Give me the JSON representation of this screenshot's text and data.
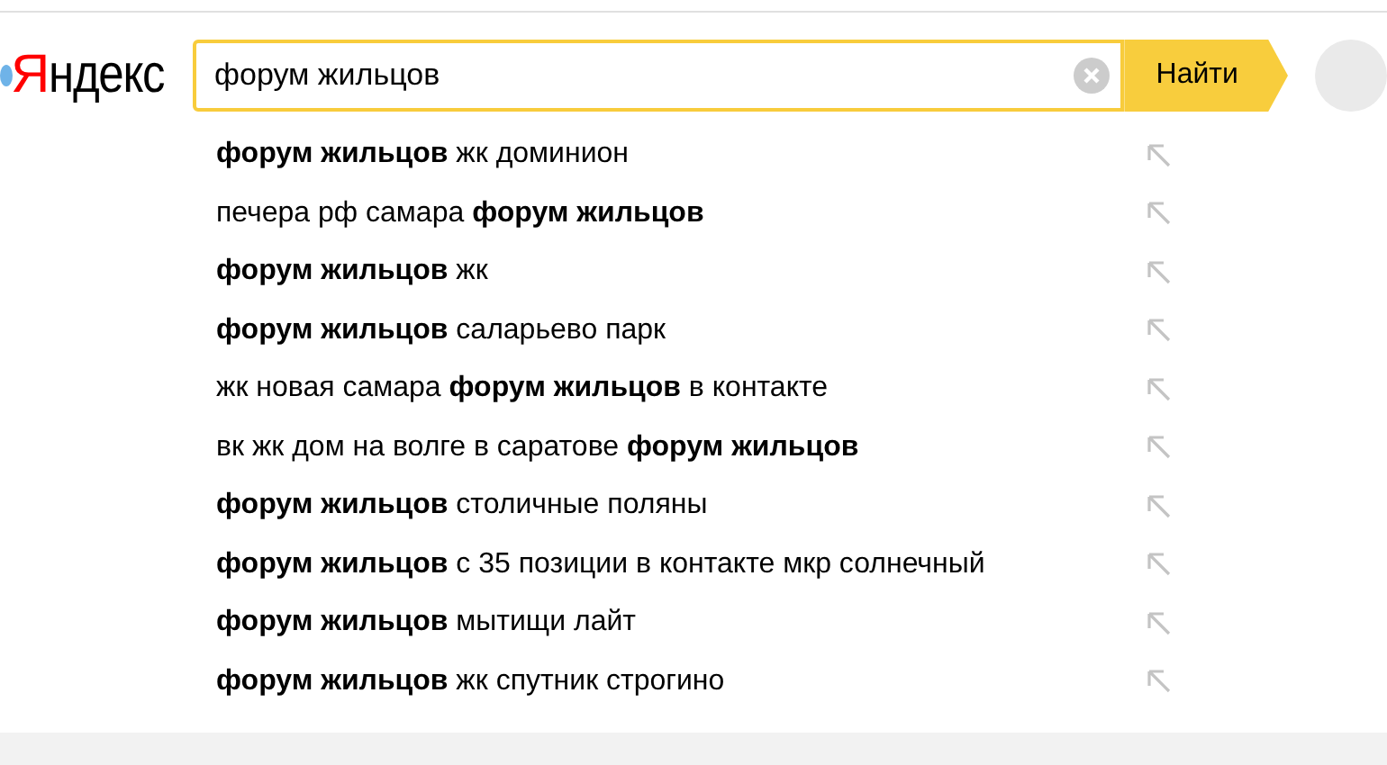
{
  "logo": {
    "first_letter": "Я",
    "rest": "ндекс"
  },
  "search": {
    "value": "форум жильцов",
    "button": "Найти"
  },
  "suggestions": [
    "**форум жильцов** жк доминион",
    "печера рф самара **форум жильцов**",
    "**форум жильцов** жк",
    "**форум жильцов** саларьево парк",
    "жк новая самара **форум жильцов** в контакте",
    "вк жк дом на волге в саратове **форум жильцов**",
    "**форум жильцов** столичные поляны",
    "**форум жильцов** с 35 позиции в контакте мкр солнечный",
    "**форум жильцов** мытищи лайт",
    "**форум жильцов** жк спутник строгино"
  ]
}
